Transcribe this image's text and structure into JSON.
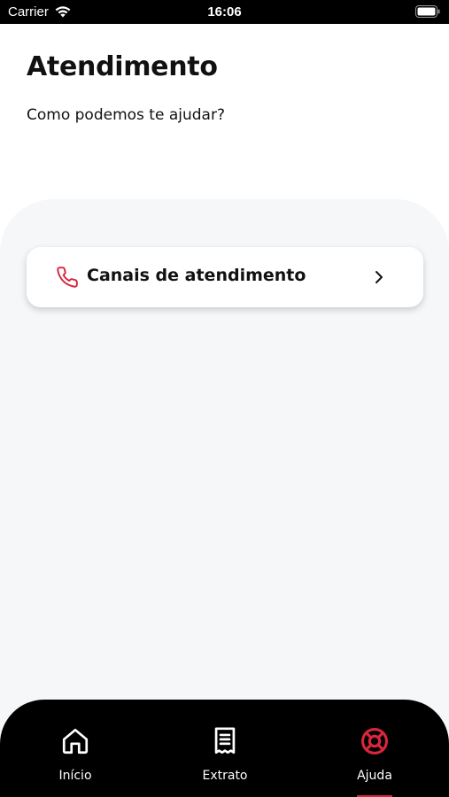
{
  "status_bar": {
    "carrier": "Carrier",
    "time": "16:06"
  },
  "header": {
    "title": "Atendimento",
    "subtitle": "Como podemos te ajudar?"
  },
  "card": {
    "label": "Canais de atendimento"
  },
  "tabs": [
    {
      "label": "Início",
      "icon": "home-icon",
      "active": false
    },
    {
      "label": "Extrato",
      "icon": "receipt-icon",
      "active": false
    },
    {
      "label": "Ajuda",
      "icon": "lifebuoy-icon",
      "active": true
    }
  ],
  "colors": {
    "accent": "#d7263d",
    "panel": "#f6f7f9",
    "tabbar": "#000000"
  }
}
